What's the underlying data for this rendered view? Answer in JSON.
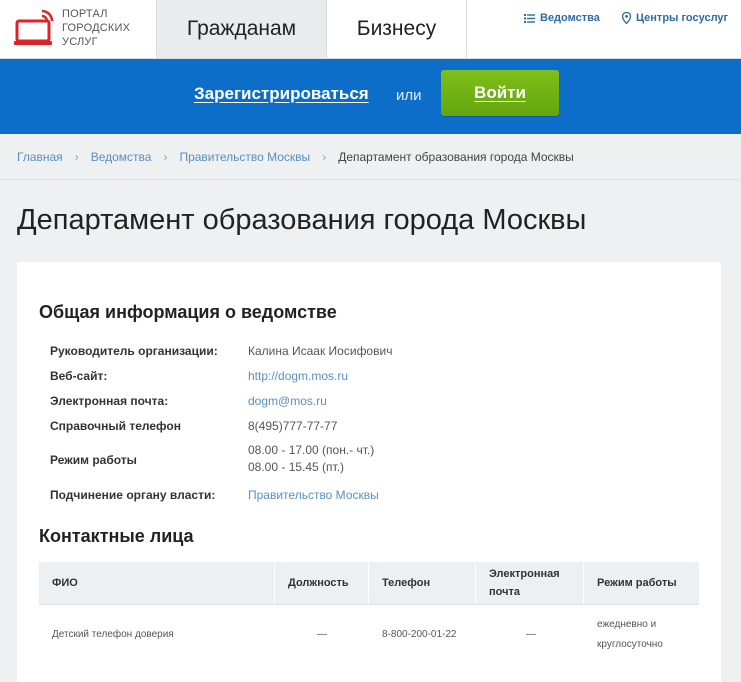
{
  "header": {
    "logo_lines": [
      "ПОРТАЛ",
      "ГОРОДСКИХ",
      "УСЛУГ"
    ],
    "logo_icon": "laptop-signal-icon",
    "tabs": [
      {
        "label": "Гражданам",
        "active": true
      },
      {
        "label": "Бизнесу",
        "active": false
      }
    ],
    "links": {
      "agencies": {
        "label": "Ведомства",
        "icon": "list-icon"
      },
      "centers": {
        "label": "Центры госуслуг",
        "icon": "location-pin-icon"
      }
    }
  },
  "banner": {
    "register_label": "Зарегистрироваться",
    "or_text": "или",
    "login_label": "Войти",
    "colors": {
      "background": "#0c6ec8",
      "login": "#72b215"
    }
  },
  "breadcrumb": {
    "items": [
      "Главная",
      "Ведомства",
      "Правительство Москвы"
    ],
    "current": "Департамент образования города Москвы"
  },
  "page_title": "Департамент образования города Москвы",
  "general_info": {
    "title": "Общая информация о ведомстве",
    "rows": [
      {
        "label": "Руководитель организации:",
        "value": [
          "Калина Исаак Иосифович"
        ]
      },
      {
        "label": "Веб-сайт:",
        "value": [
          "http://dogm.mos.ru"
        ]
      },
      {
        "label": "Электронная почта:",
        "value": [
          "dogm@mos.ru"
        ]
      },
      {
        "label": "Справочный телефон",
        "value": [
          "8(495)777-77-77"
        ]
      },
      {
        "label": "Режим работы",
        "value": [
          "08.00 - 17.00 (пон.- чт.)",
          "08.00 - 15.45 (пт.)"
        ]
      },
      {
        "label": "Подчинение органу власти:",
        "value": [
          "Правительство Москвы"
        ]
      }
    ]
  },
  "contacts": {
    "title": "Контактные лица",
    "columns": [
      "ФИО",
      "Должность",
      "Телефон",
      "Электронная почта",
      "Режим работы"
    ],
    "rows": [
      {
        "name": "Детский телефон доверия",
        "position": "—",
        "phone": "8-800-200-01-22",
        "email": "—",
        "schedule": "ежедневно и круглосуточно"
      }
    ]
  }
}
